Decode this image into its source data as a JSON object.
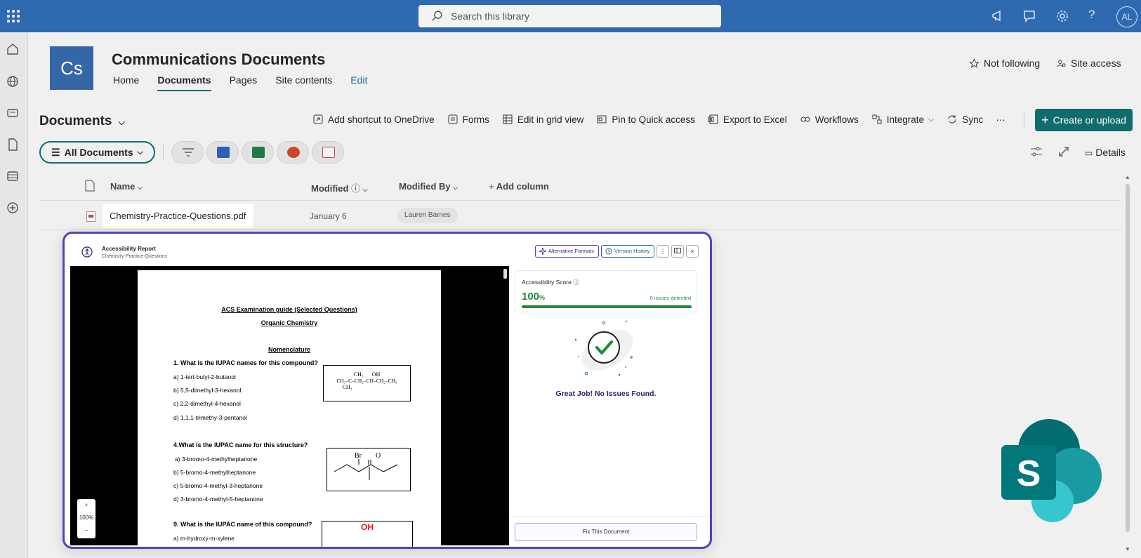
{
  "topbar": {
    "search_placeholder": "Search this library",
    "avatar": "AL",
    "help": "?"
  },
  "site": {
    "logo": "Cs",
    "title": "Communications Documents",
    "nav": [
      "Home",
      "Documents",
      "Pages",
      "Site contents",
      "Edit"
    ],
    "not_following": "Not following",
    "site_access": "Site access"
  },
  "library": {
    "title": "Documents",
    "commands": {
      "shortcut": "Add shortcut to OneDrive",
      "forms": "Forms",
      "grid": "Edit in grid view",
      "pin": "Pin to Quick access",
      "export": "Export to Excel",
      "workflows": "Workflows",
      "integrate": "Integrate",
      "sync": "Sync",
      "more": "···",
      "create": "Create or upload"
    },
    "view_name": "All Documents",
    "details": "Details",
    "columns": {
      "name": "Name",
      "modified": "Modified",
      "modified_by": "Modified By",
      "add": "Add column"
    },
    "file": {
      "name": "Chemistry-Practice-Questions.pdf",
      "modified": "January 6",
      "modified_by": "Lauren Barnes"
    }
  },
  "modal": {
    "title": "Accessibility Report",
    "subtitle": "Chemistry-Practice-Questions",
    "alt_formats": "Alternative Formats",
    "version_history": "Version History",
    "more": "⋮",
    "close": "×",
    "zoom": {
      "plus": "+",
      "level": "100%",
      "minus": "−"
    },
    "score_label": "Accessibility Score",
    "score_value": "100",
    "score_unit": "%",
    "score_fraction": 1.0,
    "issues": "0 issues detected",
    "message": "Great Job! No Issues Found.",
    "fix": "Fix This Document"
  },
  "pdf": {
    "heading1": "ACS Examination guide (Selected Questions)",
    "heading2": "Organic Chemistry",
    "heading3": "Nomenclature",
    "q1": "1. What is the IUPAC names for this compound?",
    "q1_answers": [
      "a) 1-tert-butyl-2-butanol",
      "b) 5,5-dimethyl-3-hexanol",
      "c) 2,2-dimethyl-4-hexanol",
      "d) 1,1,1-trimethy-3-pentanol"
    ],
    "q4": "4.What is the IUPAC name for this structure?",
    "q4_answers": [
      "a) 3-bromo-4-methylheptanone",
      "b) 5-bromo-4-methylheptanone",
      "c) 5-bromo-4-methyl-3-heptanone",
      "d) 3-bromo-4-methyl-5-heptanone"
    ],
    "q9": "9. What is the IUPAC name of this compound?",
    "q9_answer": "a) m-hydroxy-m-xylene",
    "struct1": {
      "top": "CH₃      OH",
      "mid": "CH₃–C–CH₂–CH–CH₂–CH₃",
      "bot": "CH₃"
    },
    "struct2": {
      "br": "Br",
      "o": "O"
    },
    "struct3": {
      "oh": "OH"
    }
  },
  "colors": {
    "brand": "#2f6ab0",
    "teal": "#0f6c6c",
    "purple": "#5b3fb4",
    "green": "#1e8a3a"
  }
}
